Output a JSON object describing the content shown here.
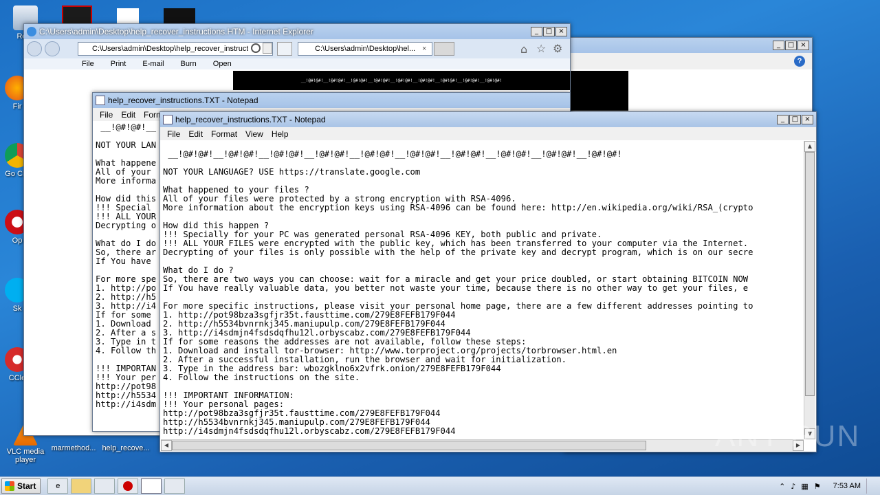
{
  "desktop": {
    "icons": [
      {
        "label": "Recy"
      },
      {
        "label": "Fir"
      },
      {
        "label": "Go Chr"
      },
      {
        "label": "Op"
      },
      {
        "label": "Sk"
      },
      {
        "label": "CCle"
      },
      {
        "label": "VLC media player"
      },
      {
        "label": "marmethod..."
      },
      {
        "label": "help_recove..."
      }
    ]
  },
  "ie_window": {
    "title": "C:\\Users\\admin\\Desktop\\help_recover_instructions.HTM - Internet Explorer",
    "address": "C:\\Users\\admin\\Desktop\\help_recover_instruct",
    "tab_label": "C:\\Users\\admin\\Desktop\\hel...",
    "menu": [
      "File",
      "Print",
      "E-mail",
      "Burn",
      "Open"
    ],
    "banner_text": "__!@#!@#!__!@#!@#!__!@#!@#!__!@#!@#!__!@#!@#!__!@#!@#!__!@#!@#!__!@#!@#!__!@#!@#!"
  },
  "notepad_back": {
    "title": "help_recover_instructions.TXT - Notepad",
    "menu": [
      "File",
      "Edit",
      "Forma"
    ],
    "lines": [
      " __!@#!@#!__",
      "",
      "NOT YOUR LAN",
      "",
      "What happene",
      "All of your",
      "More informa",
      "",
      "How did this",
      "!!! Special",
      "!!! ALL YOUR",
      "Decrypting o",
      "",
      "What do I do",
      "So, there ar",
      "If You have",
      "",
      "For more spe",
      "1. http://po",
      "2. http://h5",
      "3. http://i4",
      "If for some",
      "1. Download",
      "2. After a s",
      "3. Type in t",
      "4. Follow th",
      "",
      "!!! IMPORTAN",
      "!!! Your per",
      "http://pot98",
      "http://h5534",
      "http://i4sdm"
    ]
  },
  "notepad_front": {
    "title": "help_recover_instructions.TXT - Notepad",
    "menu": [
      "File",
      "Edit",
      "Format",
      "View",
      "Help"
    ],
    "lines": [
      "",
      " __!@#!@#!__!@#!@#!__!@#!@#!__!@#!@#!__!@#!@#!__!@#!@#!__!@#!@#!__!@#!@#!__!@#!@#!__!@#!@#!",
      "",
      "NOT YOUR LANGUAGE? USE https://translate.google.com",
      "",
      "What happened to your files ?",
      "All of your files were protected by a strong encryption with RSA-4096.",
      "More information about the encryption keys using RSA-4096 can be found here: http://en.wikipedia.org/wiki/RSA_(crypto",
      "",
      "How did this happen ?",
      "!!! Specially for your PC was generated personal RSA-4096 KEY, both public and private.",
      "!!! ALL YOUR FILES were encrypted with the public key, which has been transferred to your computer via the Internet.",
      "Decrypting of your files is only possible with the help of the private key and decrypt program, which is on our secre",
      "",
      "What do I do ?",
      "So, there are two ways you can choose: wait for a miracle and get your price doubled, or start obtaining BITCOIN NOW",
      "If You have really valuable data, you better not waste your time, because there is no other way to get your files, e",
      "",
      "For more specific instructions, please visit your personal home page, there are a few different addresses pointing to",
      "1. http://pot98bza3sgfjr35t.fausttime.com/279E8FEFB179F044",
      "2. http://h5534bvnrnkj345.maniupulp.com/279E8FEFB179F044",
      "3. http://i4sdmjn4fsdsdqfhu12l.orbyscabz.com/279E8FEFB179F044",
      "If for some reasons the addresses are not available, follow these steps:",
      "1. Download and install tor-browser: http://www.torproject.org/projects/torbrowser.html.en",
      "2. After a successful installation, run the browser and wait for initialization.",
      "3. Type in the address bar: wbozgklno6x2vfrk.onion/279E8FEFB179F044",
      "4. Follow the instructions on the site.",
      "",
      "!!! IMPORTANT INFORMATION:",
      "!!! Your personal pages:",
      "http://pot98bza3sgfjr35t.fausttime.com/279E8FEFB179F044",
      "http://h5534bvnrnkj345.maniupulp.com/279E8FEFB179F044",
      "http://i4sdmjn4fsdsdqfhu12l.orbyscabz.com/279E8FEFB179F044"
    ]
  },
  "taskbar": {
    "start_label": "Start",
    "clock": "7:53 AM"
  },
  "watermark": "ANY RUN"
}
